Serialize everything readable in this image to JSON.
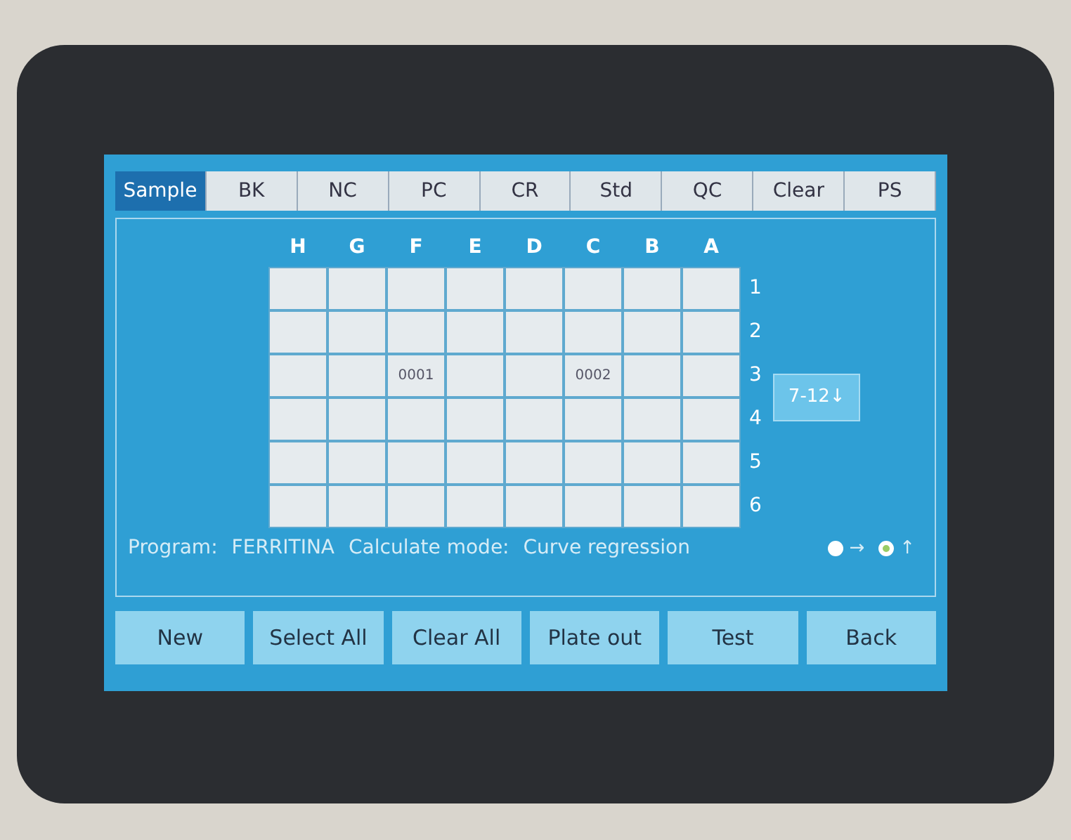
{
  "tabs": [
    {
      "label": "Sample",
      "selected": true
    },
    {
      "label": "BK",
      "selected": false
    },
    {
      "label": "NC",
      "selected": false
    },
    {
      "label": "PC",
      "selected": false
    },
    {
      "label": "CR",
      "selected": false
    },
    {
      "label": "Std",
      "selected": false
    },
    {
      "label": "QC",
      "selected": false
    },
    {
      "label": "Clear",
      "selected": false
    },
    {
      "label": "PS",
      "selected": false
    }
  ],
  "plate": {
    "columns": [
      "H",
      "G",
      "F",
      "E",
      "D",
      "C",
      "B",
      "A"
    ],
    "rows": [
      {
        "label": "1",
        "cells": [
          {},
          {},
          {},
          {},
          {},
          {},
          {},
          {}
        ]
      },
      {
        "label": "2",
        "cells": [
          {},
          {},
          {},
          {},
          {},
          {},
          {},
          {}
        ]
      },
      {
        "label": "3",
        "cells": [
          {},
          {},
          {
            "text": "0001"
          },
          {},
          {},
          {
            "text": "0002"
          },
          {},
          {}
        ]
      },
      {
        "label": "4",
        "cells": [
          {},
          {},
          {},
          {},
          {},
          {},
          {},
          {}
        ]
      },
      {
        "label": "5",
        "cells": [
          {},
          {},
          {},
          {},
          {},
          {},
          {},
          {}
        ]
      },
      {
        "label": "6",
        "cells": [
          {},
          {},
          {},
          {},
          {},
          {},
          {},
          {}
        ]
      }
    ],
    "page_button": "7-12↓",
    "directions": [
      {
        "arrow": "→",
        "selected": false
      },
      {
        "arrow": "↑",
        "selected": true
      }
    ]
  },
  "status": {
    "program_label": "Program:",
    "program": "FERRITINA",
    "mode_label": "Calculate mode:",
    "mode": "Curve regression"
  },
  "buttons": [
    "New",
    "Select All",
    "Clear All",
    "Plate out",
    "Test",
    "Back"
  ]
}
